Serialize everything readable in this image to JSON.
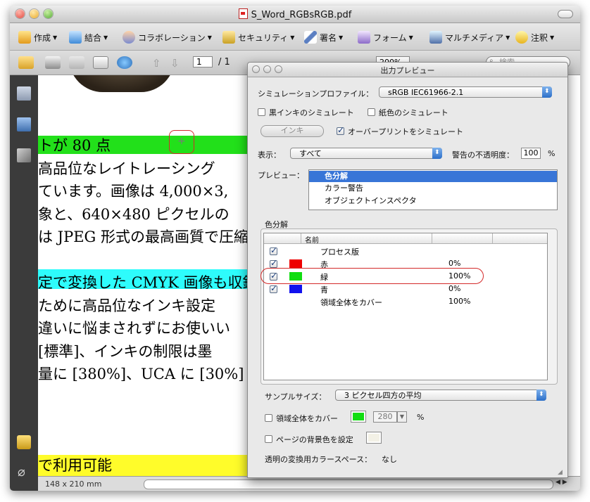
{
  "window": {
    "title": "S_Word_RGBsRGB.pdf"
  },
  "toolbar": {
    "items": [
      {
        "label": "作成",
        "icon": "create-pdf-icon"
      },
      {
        "label": "結合",
        "icon": "combine-icon"
      },
      {
        "label": "コラボレーション",
        "icon": "collaboration-icon"
      },
      {
        "label": "セキュリティ",
        "icon": "lock-icon"
      },
      {
        "label": "署名",
        "icon": "pen-icon"
      },
      {
        "label": "フォーム",
        "icon": "form-icon"
      },
      {
        "label": "マルチメディア",
        "icon": "multimedia-icon"
      },
      {
        "label": "注釈",
        "icon": "comment-icon"
      }
    ]
  },
  "nav": {
    "page": "1",
    "total": "/ 1",
    "zoom": "200%",
    "search_placeholder": "検索"
  },
  "document": {
    "lines": [
      "トが 80 点",
      "高品位なレイトレーシング",
      "ています。画像は 4,000×3,",
      "象と、640×480 ピクセルの",
      "は JPEG 形式の最高画質で圧縮",
      "",
      "定で変換した CMYK 画像も収録",
      "ために高品位なインキ設定",
      "違いに悩まされずにお使いい",
      "[標準]、インキの制限は墨",
      "量に [380%]、UCA に [30%]",
      "",
      "",
      "で利用可能"
    ],
    "page_size": "148 x 210 mm",
    "highlight_green": "#22e01a",
    "highlight_cyan": "#2efcfc",
    "highlight_yellow": "#fffc2a"
  },
  "panel": {
    "title": "出力プレビュー",
    "sim_profile_label": "シミュレーションプロファイル：",
    "sim_profile_value": "sRGB IEC61966-2.1",
    "black_ink_label": "黒インキのシミュレート",
    "paper_color_label": "紙色のシミュレート",
    "ink_button": "インキ",
    "overprint_label": "オーバープリントをシミュレート",
    "show_label": "表示：",
    "show_value": "すべて",
    "warning_opacity_label": "警告の不透明度：",
    "warning_opacity_value": "100",
    "percent": "%",
    "preview_label": "プレビュー：",
    "preview_items": [
      "色分解",
      "カラー警告",
      "オブジェクトインスペクタ"
    ],
    "separations_label": "色分解",
    "column_name": "名前",
    "separations": [
      {
        "name": "プロセス版",
        "value": "",
        "color": ""
      },
      {
        "name": "赤",
        "value": "0%",
        "color": "#ee0000"
      },
      {
        "name": "緑",
        "value": "100%",
        "color": "#11dd11"
      },
      {
        "name": "青",
        "value": "0%",
        "color": "#1111ee"
      },
      {
        "name": "領域全体をカバー",
        "value": "100%",
        "color": ""
      }
    ],
    "sample_size_label": "サンプルサイズ：",
    "sample_size_value": "3 ピクセル四方の平均",
    "total_area_label": "領域全体をカバー",
    "total_area_value": "280",
    "total_area_unit": "%",
    "bg_color_label": "ページの背景色を設定",
    "transparency_label": "透明の変換用カラースペース：",
    "transparency_value": "なし"
  }
}
